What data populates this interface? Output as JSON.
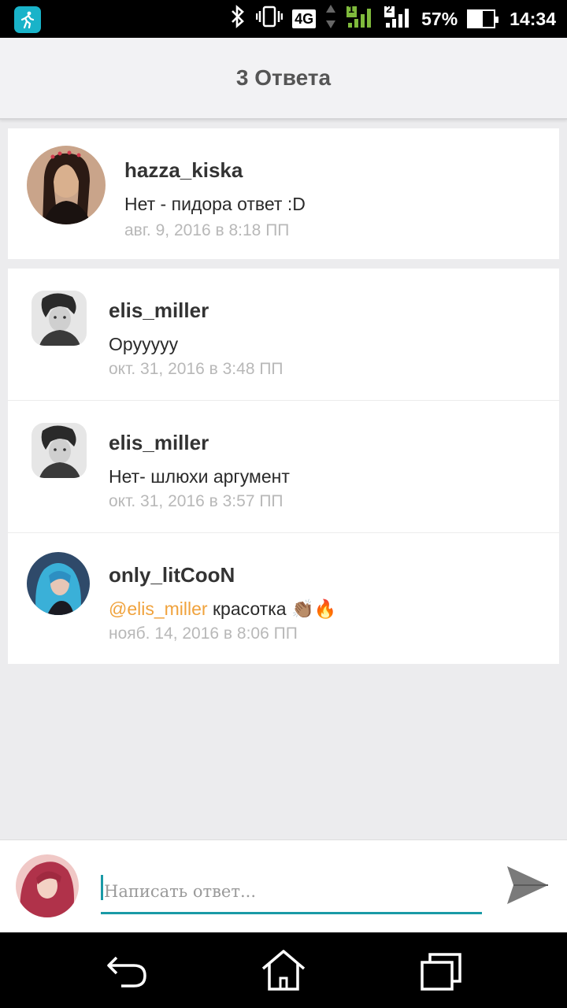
{
  "statusbar": {
    "network": "4G",
    "sim1": "1",
    "sim2": "2",
    "battery_text": "57%",
    "battery_level": 0.57,
    "time": "14:34"
  },
  "header": {
    "title": "3 Ответа"
  },
  "parent_comment": {
    "username": "hazza_kiska",
    "text": "Нет - пидора ответ :D",
    "time": "авг. 9, 2016 в 8:18 ПП"
  },
  "replies": [
    {
      "username": "elis_miller",
      "text": "Орyyyyy",
      "time": "окт. 31, 2016 в 3:48 ПП"
    },
    {
      "username": "elis_miller",
      "text": "Нет- шлюхи аргумент",
      "time": "окт. 31, 2016 в 3:57 ПП"
    },
    {
      "username": "only_litCooN",
      "mention": "@elis_miller",
      "text": " красотка 👏🏽🔥",
      "time": "нояб. 14, 2016 в 8:06 ПП"
    }
  ],
  "reply_bar": {
    "placeholder": "Написать ответ..."
  },
  "colors": {
    "accent": "#1a9aa6",
    "mention": "#f0a23c",
    "app_icon": "#19b3c9"
  }
}
